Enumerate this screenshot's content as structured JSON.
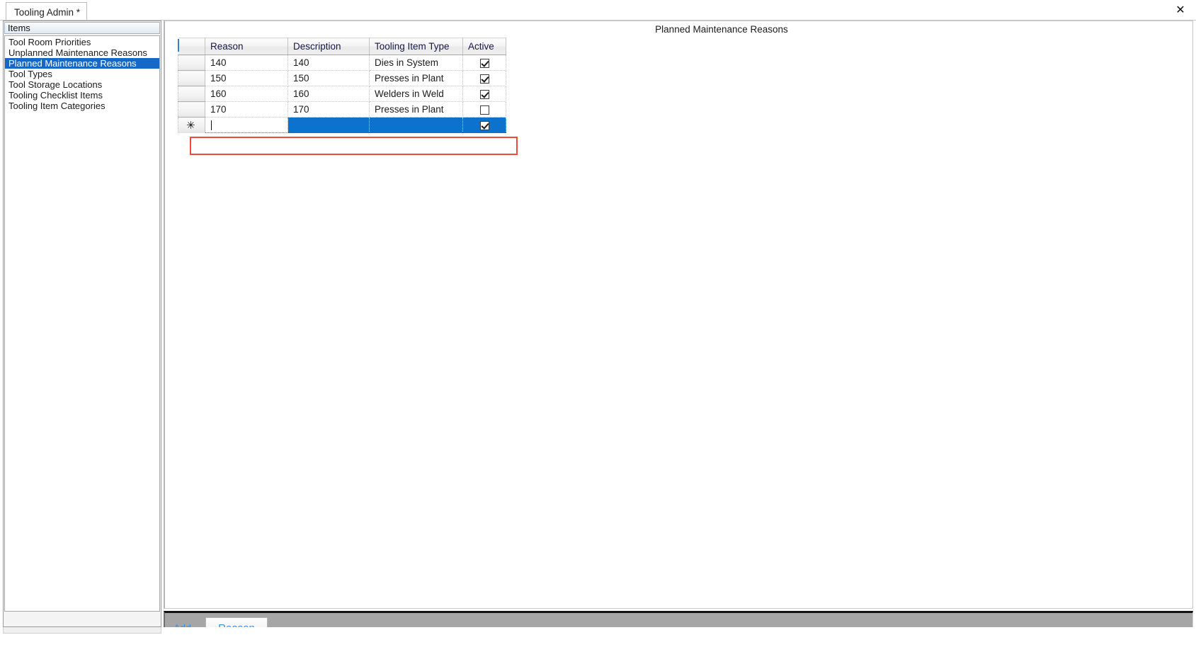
{
  "window": {
    "close_label": "✕"
  },
  "tabs": [
    {
      "label": "Tooling Admin *"
    }
  ],
  "sidebar": {
    "header": "Items",
    "items": [
      {
        "label": "Tool Room Priorities",
        "selected": false
      },
      {
        "label": "Unplanned Maintenance Reasons",
        "selected": false
      },
      {
        "label": "Planned Maintenance Reasons",
        "selected": true
      },
      {
        "label": "Tool Types",
        "selected": false
      },
      {
        "label": "Tool Storage Locations",
        "selected": false
      },
      {
        "label": "Tooling Checklist Items",
        "selected": false
      },
      {
        "label": "Tooling Item Categories",
        "selected": false
      }
    ]
  },
  "main": {
    "title": "Planned Maintenance Reasons"
  },
  "grid": {
    "columns": [
      {
        "label": "Reason"
      },
      {
        "label": "Description"
      },
      {
        "label": "Tooling Item Type"
      },
      {
        "label": "Active"
      }
    ],
    "rows": [
      {
        "reason": "140",
        "description": "140",
        "tooling_item_type": "Dies in System",
        "active": true
      },
      {
        "reason": "150",
        "description": "150",
        "tooling_item_type": "Presses in Plant",
        "active": true
      },
      {
        "reason": "160",
        "description": "160",
        "tooling_item_type": "Welders in Weld",
        "active": true
      },
      {
        "reason": "170",
        "description": "170",
        "tooling_item_type": "Presses in Plant",
        "active": false
      }
    ],
    "new_row": {
      "marker": "✳",
      "reason": "",
      "description": "",
      "tooling_item_type": "",
      "active": true
    }
  },
  "toolbar": {
    "add_label": "Add ...",
    "reason_button": "Reason"
  },
  "colors": {
    "selection_blue": "#0d72ce",
    "list_selection_blue": "#1668c8",
    "new_row_outline_red": "#f24a3a",
    "toolbar_gray": "#a6a6a6",
    "link_blue": "#3a8ee0"
  }
}
